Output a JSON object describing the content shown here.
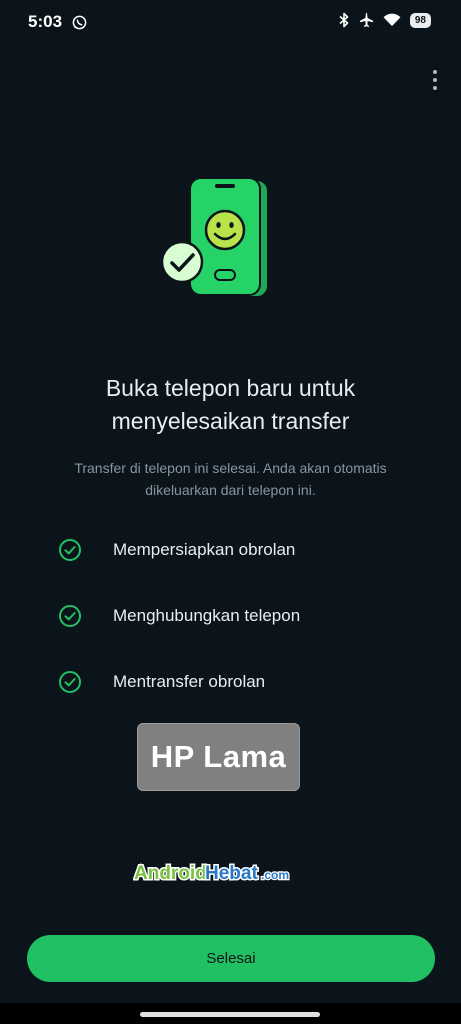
{
  "status_bar": {
    "time": "5:03",
    "battery": "98",
    "icons": [
      "whatsapp-icon",
      "bluetooth-icon",
      "airplane-icon",
      "wifi-icon"
    ]
  },
  "header": {
    "menu_icon": "more-vert-icon"
  },
  "hero": {
    "title": "Buka telepon baru untuk menyelesaikan transfer",
    "subtitle": "Transfer di telepon ini selesai. Anda akan otomatis dikeluarkan dari telepon ini."
  },
  "steps": [
    {
      "label": "Mempersiapkan obrolan",
      "status": "done"
    },
    {
      "label": "Menghubungkan telepon",
      "status": "done"
    },
    {
      "label": "Mentransfer obrolan",
      "status": "done"
    }
  ],
  "overlay_label": "HP Lama",
  "watermark": "AndroidHebat.com",
  "footer": {
    "done_label": "Selesai"
  },
  "colors": {
    "background": "#0b141a",
    "accent": "#21c063",
    "phone_green": "#25d366",
    "smiley": "#b8e34a",
    "text_primary": "#e9edef",
    "text_secondary": "#8696a0"
  }
}
